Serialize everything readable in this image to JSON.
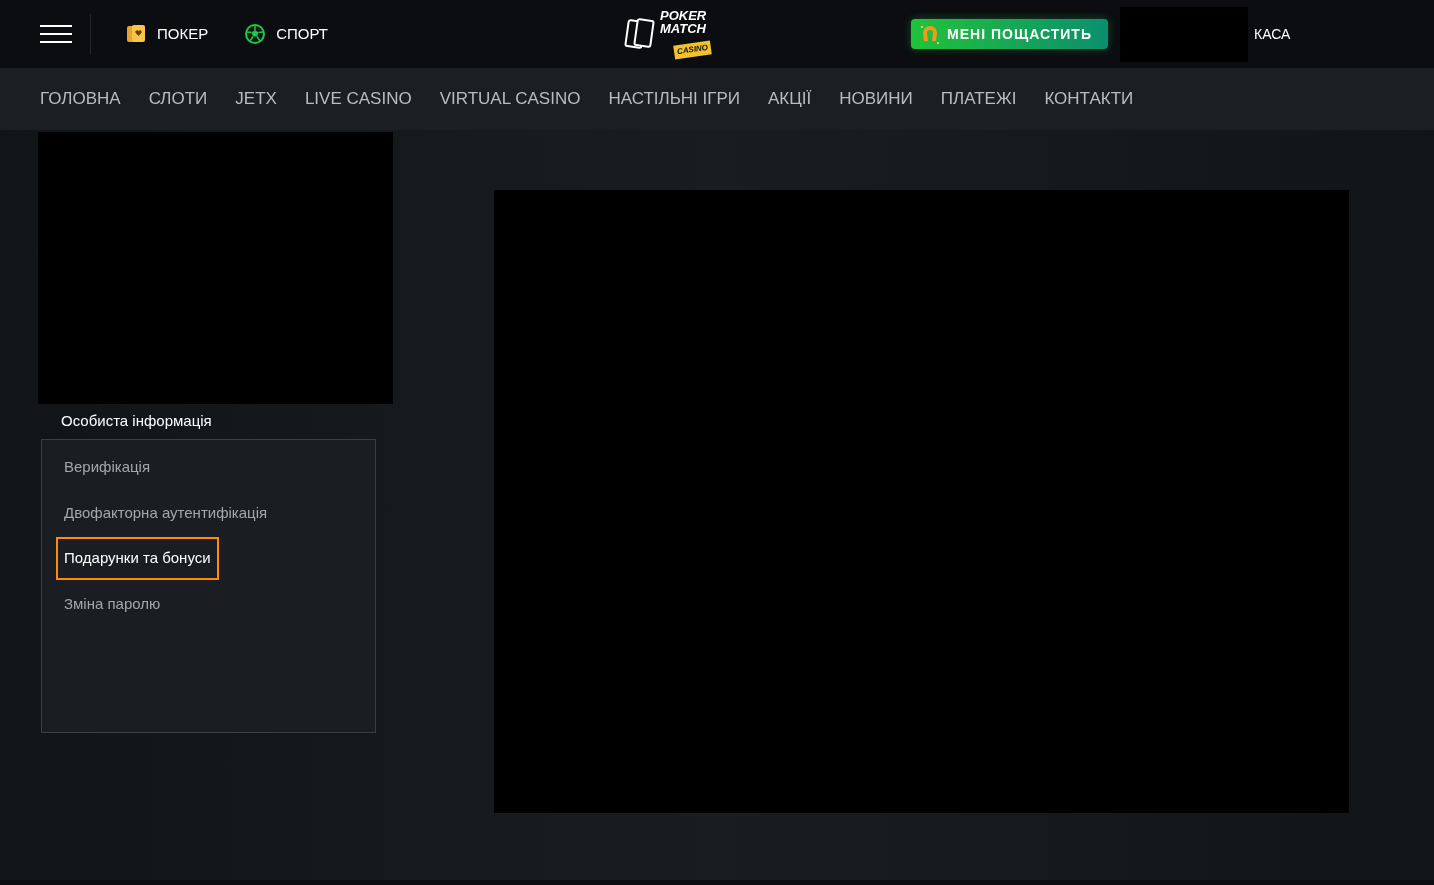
{
  "header": {
    "top_links": [
      {
        "kind": "cards",
        "label": "ПОКЕР"
      },
      {
        "kind": "ball",
        "label": "СПОРТ"
      }
    ],
    "logo": {
      "line_1": "POKER",
      "line_2": "MATCH",
      "badge": "CASINO"
    },
    "promo_button": "МЕНІ ПОЩАСТИТЬ",
    "cashier_link": "КАСА"
  },
  "nav": [
    {
      "label": "ГОЛОВНА"
    },
    {
      "label": "СЛОТИ"
    },
    {
      "label": "JETX"
    },
    {
      "label": "LIVE CASINO"
    },
    {
      "label": "VIRTUAL CASINO"
    },
    {
      "label": "НАСТІЛЬНІ ІГРИ"
    },
    {
      "label": "АКЦІЇ"
    },
    {
      "label": "НОВИНИ"
    },
    {
      "label": "ПЛАТЕЖІ"
    },
    {
      "label": "КОНТАКТИ"
    }
  ],
  "sidebar": {
    "heading": "Особиста інформація",
    "items": [
      {
        "label": "Верифікація",
        "selected": false
      },
      {
        "label": "Двофакторна аутентифікація",
        "selected": false
      },
      {
        "label": "Подарунки та бонуси",
        "selected": true
      },
      {
        "label": "Зміна паролю",
        "selected": false
      }
    ]
  }
}
